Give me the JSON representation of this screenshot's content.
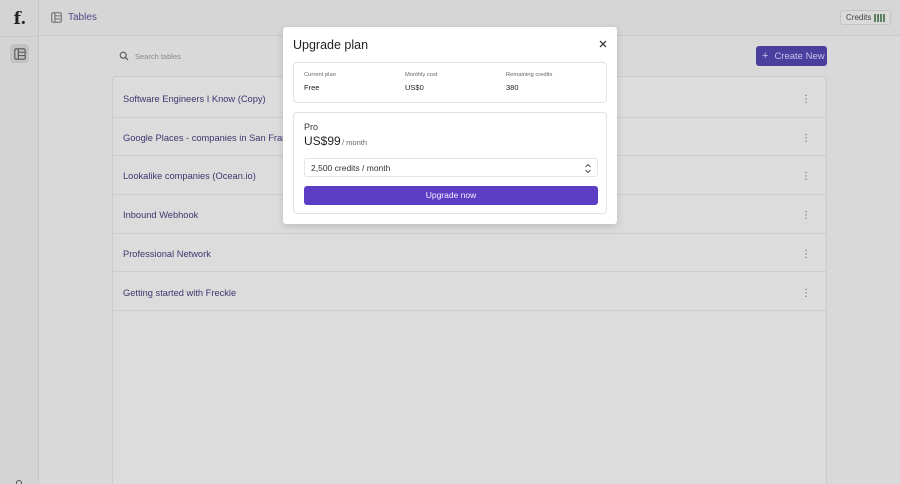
{
  "app": {
    "logo_text": "f."
  },
  "header": {
    "title": "Tables"
  },
  "credits": {
    "label": "Credits"
  },
  "search": {
    "placeholder": "Search tables"
  },
  "toolbar": {
    "create_label": "Create New"
  },
  "tables": [
    "Software Engineers I Know (Copy)",
    "Google Places - companies in San Francisco",
    "Lookalike companies (Ocean.io)",
    "Inbound Webhook",
    "Professional Network",
    "Getting started with Freckle"
  ],
  "modal": {
    "title": "Upgrade plan",
    "current": {
      "plan_label": "Current plan",
      "plan_value": "Free",
      "cost_label": "Monthly cost",
      "cost_value": "US$0",
      "remaining_label": "Remaining credits",
      "remaining_value": "380"
    },
    "pro": {
      "name": "Pro",
      "price": "US$99",
      "period": "/ month",
      "selected_option": "2,500 credits / month",
      "upgrade_label": "Upgrade now"
    }
  },
  "colors": {
    "accent": "#5c3ec4",
    "create_button": "#4b3f9e",
    "link_text": "#3c376e"
  }
}
